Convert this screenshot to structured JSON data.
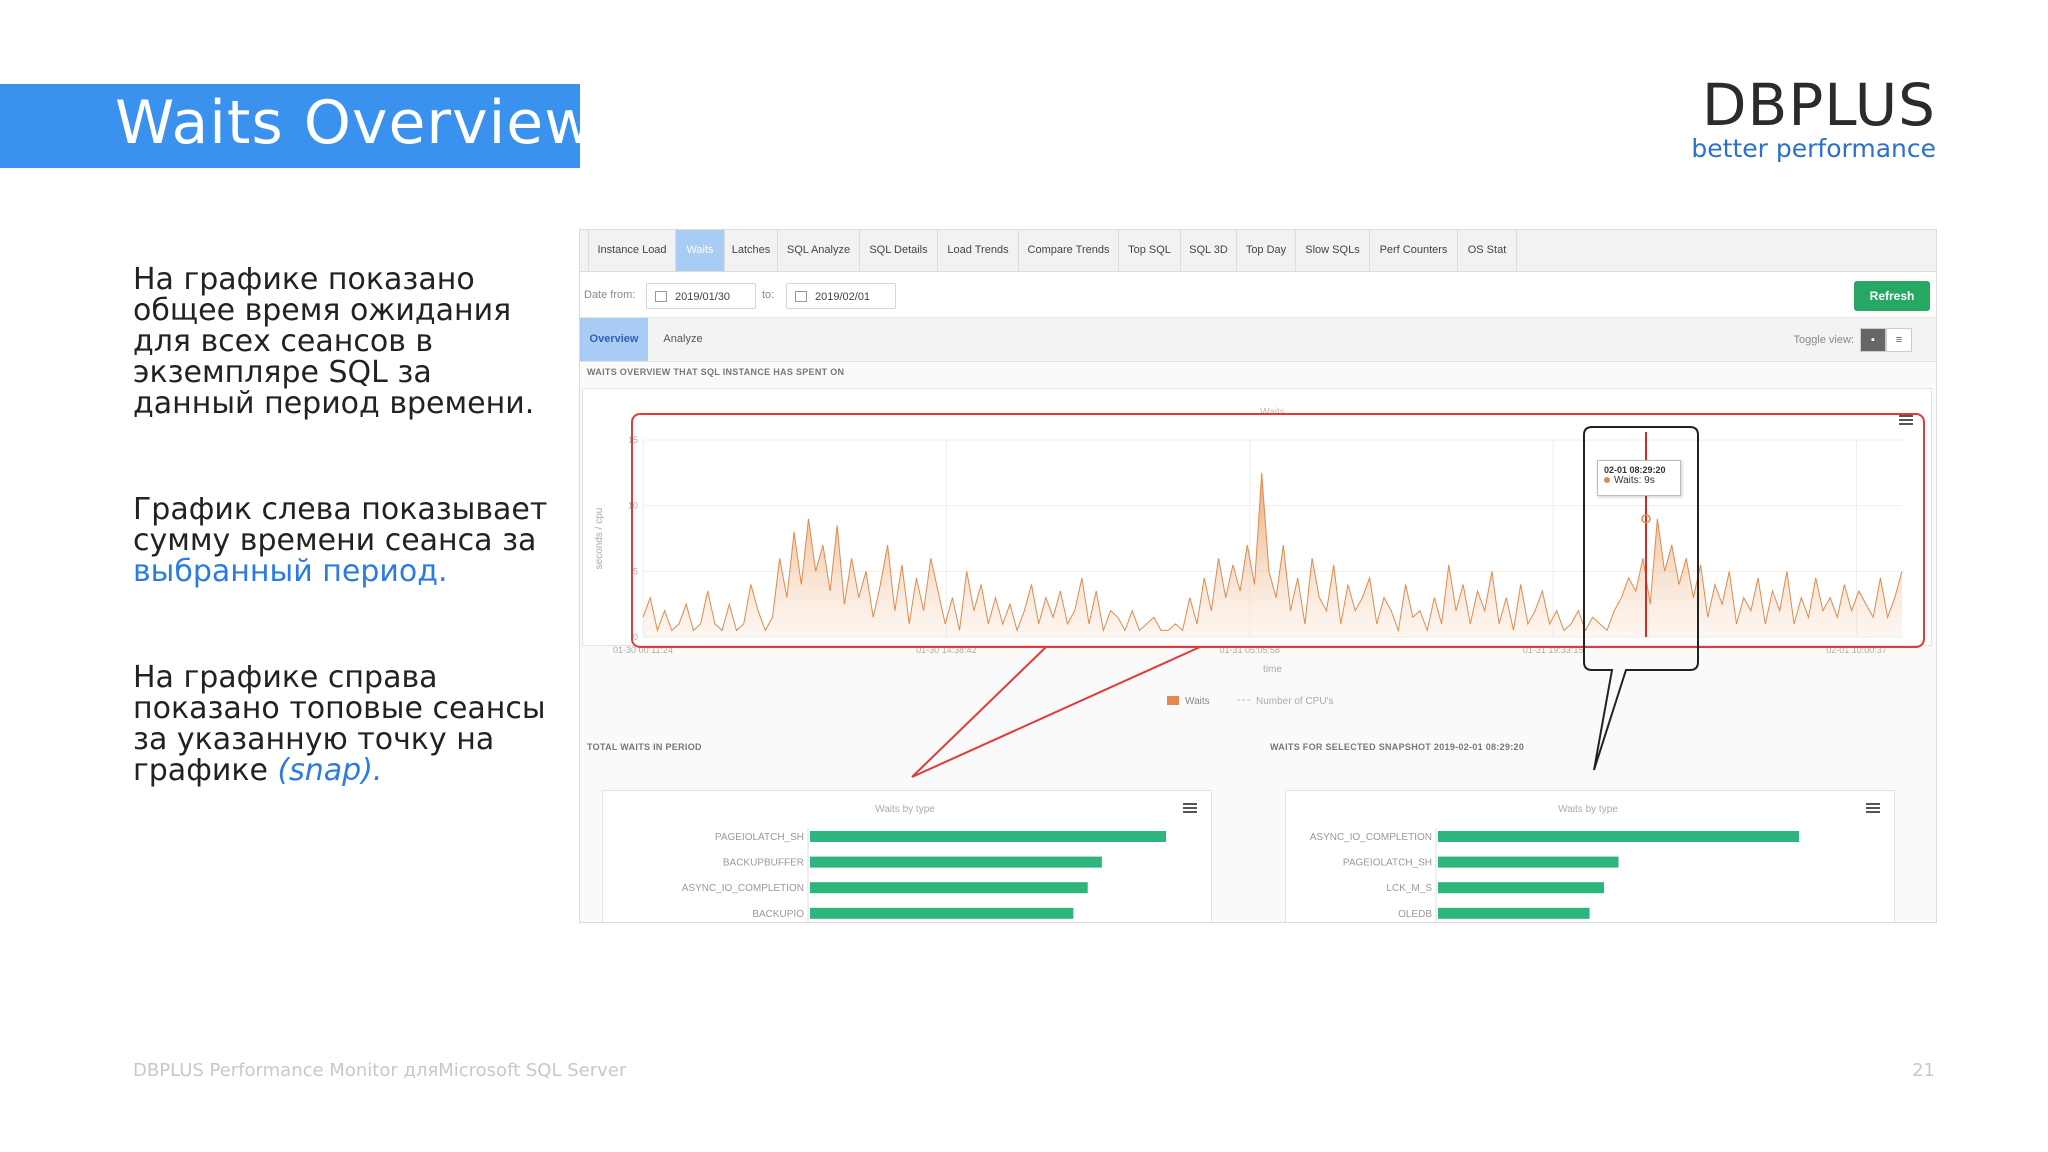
{
  "slide": {
    "title": "Waits Overview",
    "logo_main": "DBPLUS",
    "logo_sub": "better performance",
    "p1": "На графике показано общее время ожидания для всех сеансов в экземпляре SQL за данный период времени.",
    "p2_plain": "График слева показывает сумму времени сеанса за ",
    "p2_highlight": "выбранный период.",
    "p3_plain": "На графике справа показано топовые сеансы за указанную точку на графике ",
    "p3_highlight": "(snap).",
    "footer_left": "DBPLUS Performance Monitor дляMicrosoft SQL Server",
    "page_number": "21",
    "title_band_color": "#3b92ee",
    "accent_text_color": "#2a7be4",
    "callout_color": "#e03a3a"
  },
  "app": {
    "tabs": [
      "Instance Load",
      "Waits",
      "Latches",
      "SQL Analyze",
      "SQL Details",
      "Load Trends",
      "Compare Trends",
      "Top SQL",
      "SQL 3D",
      "Top Day",
      "Slow SQLs",
      "Perf Counters",
      "OS Stat"
    ],
    "active_tab": "Waits",
    "date_from_label": "Date from:",
    "date_from": "2019/01/30",
    "date_to_label": "to:",
    "date_to": "2019/02/01",
    "refresh_label": "Refresh",
    "subtabs": [
      "Overview",
      "Analyze"
    ],
    "active_subtab": "Overview",
    "toggle_label": "Toggle view:",
    "toggle_icons": [
      "chart-icon",
      "list-icon"
    ],
    "section_main": "WAITS OVERVIEW THAT SQL INSTANCE HAS SPENT ON",
    "section_left": "TOTAL WAITS IN PERIOD",
    "section_right": "WAITS FOR SELECTED SNAPSHOT 2019-02-01 08:29:20",
    "tooltip_date": "02-01 08:29:20",
    "tooltip_value": "Waits: 9s"
  },
  "chart_data": [
    {
      "type": "area",
      "title": "Waits",
      "xlabel": "time",
      "ylabel": "seconds / cpu",
      "ylim": [
        0,
        15
      ],
      "y_ticks": [
        "0",
        "5",
        "10",
        "15"
      ],
      "x_tick_labels": [
        "01-30 00:11:24",
        "01-30 14:38:42",
        "01-31 05:05:58",
        "01-31 19:33:15",
        "02-01 10:00:37"
      ],
      "legend": [
        "Waits",
        "Number of CPU's"
      ],
      "series": [
        {
          "name": "Waits",
          "color": "#e28a4b",
          "values": [
            1.5,
            3,
            0.5,
            2,
            0.5,
            1,
            2.5,
            0.5,
            1,
            3.5,
            1,
            0.5,
            2.5,
            0.5,
            1,
            4,
            2,
            0.5,
            1.5,
            6,
            3,
            8,
            4,
            9,
            5,
            7,
            3.5,
            8.5,
            2.5,
            6,
            3,
            5,
            1.5,
            4,
            7,
            2,
            5.5,
            1,
            4.5,
            2,
            6,
            3.5,
            1,
            3,
            0.5,
            5,
            2,
            4,
            1,
            3,
            1,
            2.5,
            0.5,
            2,
            4,
            1,
            3,
            1.5,
            3.5,
            1,
            2,
            4.5,
            1,
            3.5,
            0.5,
            2,
            1.5,
            0.5,
            2,
            0.5,
            1,
            1.5,
            0.5,
            0.5,
            1,
            0.5,
            3,
            1,
            4.5,
            2,
            6,
            3,
            5.5,
            3.5,
            7,
            4,
            12.5,
            5,
            3,
            7,
            2,
            4.5,
            1,
            6,
            3,
            2,
            5.5,
            1,
            4,
            2,
            3,
            4.5,
            1,
            3,
            2,
            0.5,
            4,
            1.5,
            2,
            0.5,
            3,
            1,
            5.5,
            2,
            4,
            1,
            3.5,
            2,
            5,
            1,
            3,
            0.5,
            4,
            1,
            2,
            3.5,
            1,
            2,
            0.5,
            1,
            2,
            0.5,
            1.5,
            1,
            0.5,
            2,
            3,
            4.5,
            3.5,
            6,
            2.5,
            9,
            5,
            7,
            4,
            6,
            3,
            5.5,
            1.5,
            4,
            2.5,
            5,
            1,
            3,
            2,
            4.5,
            1,
            3.5,
            2,
            5,
            1,
            3,
            1.5,
            4.5,
            2,
            3,
            1.5,
            4,
            2,
            3.5,
            2.5,
            1.5,
            4.5,
            1.5,
            3,
            5
          ]
        }
      ],
      "selected_point": "02-01 08:29:20",
      "selected_value": 9
    },
    {
      "type": "bar",
      "title": "Waits by type",
      "categories": [
        "PAGEIOLATCH_SH",
        "BACKUPBUFFER",
        "ASYNC_IO_COMPLETION",
        "BACKUPIO"
      ],
      "series": [
        {
          "values": [
            100,
            82,
            78,
            74
          ],
          "color": "#2cb67d"
        }
      ],
      "value_scale": "relative"
    },
    {
      "type": "bar",
      "title": "Waits by type",
      "categories": [
        "ASYNC_IO_COMPLETION",
        "PAGEIOLATCH_SH",
        "LCK_M_S",
        "OLEDB"
      ],
      "series": [
        {
          "values": [
            100,
            50,
            46,
            42
          ],
          "color": "#2cb67d"
        }
      ],
      "value_scale": "relative"
    }
  ]
}
